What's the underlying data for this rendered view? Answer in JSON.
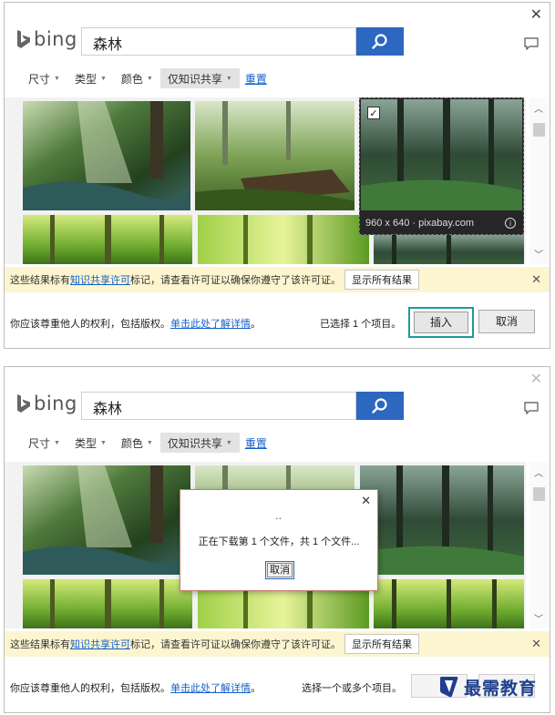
{
  "colors": {
    "brand_blue": "#2c67c0",
    "highlight_teal": "#1e9a9a",
    "notice_bg": "#fcf5cf",
    "link": "#1560c8"
  },
  "header": {
    "logo_text": "bing",
    "search_value": "森林"
  },
  "filters": {
    "items": [
      {
        "label": "尺寸",
        "icon": "chevron-down-icon"
      },
      {
        "label": "类型",
        "icon": "chevron-down-icon"
      },
      {
        "label": "颜色",
        "icon": "chevron-down-icon"
      },
      {
        "label": "仅知识共享",
        "icon": "chevron-down-icon",
        "active": true
      }
    ],
    "reset_label": "重置"
  },
  "hover_card": {
    "meta": "960 x 640 · pixabay.com",
    "checked": true
  },
  "notice": {
    "text_before": "这些结果标有",
    "link_text": "知识共享许可",
    "text_after": "标记，请查看许可证以确保你遵守了该许可证。",
    "button_label": "显示所有结果"
  },
  "footer": {
    "rights_text": "你应该尊重他人的权利，包括版权。",
    "rights_link": "单击此处了解详情",
    "rights_end": "。",
    "status_panel1": "已选择 1 个项目。",
    "status_panel2": "选择一个或多个项目。",
    "insert_label": "插入",
    "cancel_label": "取消"
  },
  "dialog": {
    "dots": "‥",
    "message": "正在下载第 1 个文件，共 1 个文件...",
    "cancel_label": "取消"
  },
  "watermark": {
    "text": "最需教育"
  }
}
